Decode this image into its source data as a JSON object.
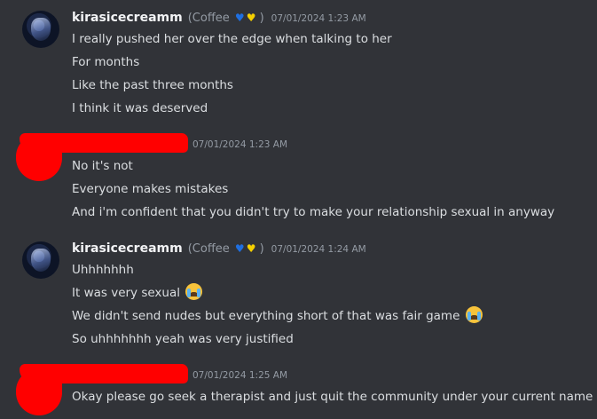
{
  "messages": [
    {
      "username": "kirasicecreamm",
      "clan": "(Coffee",
      "clan_close": ")",
      "heart_icons": [
        "blue-heart",
        "yellow-heart"
      ],
      "timestamp": "07/01/2024 1:23 AM",
      "lines": [
        "I really pushed her over the edge when talking to her",
        "For months",
        "Like the past three months",
        "I think it was deserved"
      ]
    },
    {
      "username_redacted": true,
      "timestamp": "07/01/2024 1:23 AM",
      "lines": [
        "No it's not",
        "Everyone makes mistakes",
        "And i'm confident that you didn't try to make your relationship sexual in anyway"
      ]
    },
    {
      "username": "kirasicecreamm",
      "clan": "(Coffee",
      "clan_close": ")",
      "heart_icons": [
        "blue-heart",
        "yellow-heart"
      ],
      "timestamp": "07/01/2024 1:24 AM",
      "lines": [
        "Uhhhhhhh",
        "It was very sexual",
        "We didn't send nudes but everything short of that was fair game",
        "So uhhhhhhh yeah was very justified"
      ],
      "line_emojis": [
        "",
        "loudly-crying-face",
        "loudly-crying-face",
        ""
      ]
    },
    {
      "username_redacted": true,
      "timestamp": "07/01/2024 1:25 AM",
      "lines": [
        "Okay please go seek a therapist and just quit the community under your current name"
      ]
    }
  ],
  "colors": {
    "background": "#313338",
    "text": "#dbdee1",
    "muted": "#949ba4",
    "redaction": "#ff0000"
  }
}
